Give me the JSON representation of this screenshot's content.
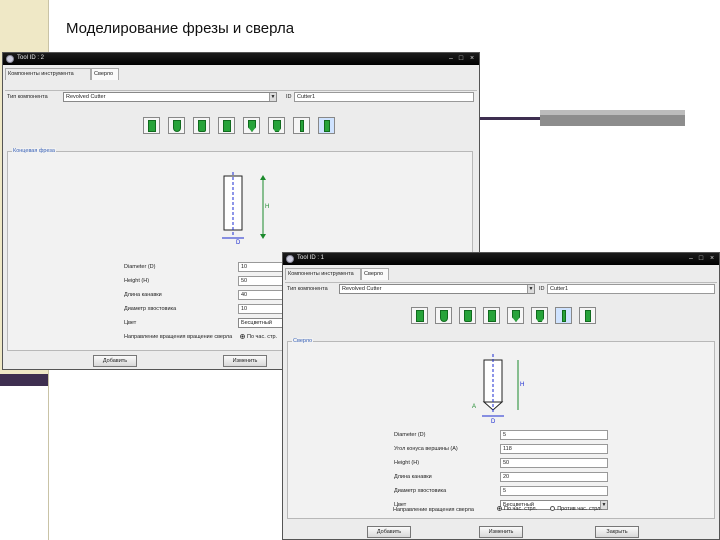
{
  "slide": {
    "title": "Моделирование фрезы и сверла"
  },
  "window1": {
    "title": "Tool ID : 2",
    "tabs": [
      "Компоненты инструмента",
      "Сверло"
    ],
    "type_label": "Тип компонента",
    "type_value": "Revolved Cutter",
    "id_label": "ID",
    "id_value": "Cutter1",
    "group_title": "Концевая фреза",
    "params": [
      {
        "label": "Diameter (D)",
        "value": "10"
      },
      {
        "label": "Height (H)",
        "value": "50"
      },
      {
        "label": "Длина канавки",
        "value": "40"
      },
      {
        "label": "Диаметр хвостовика",
        "value": "10"
      },
      {
        "label": "Цвет",
        "value": "Бесцветный"
      }
    ],
    "direction_label": "Направление вращения вращение сверла",
    "direction_option": "По час. стр.",
    "btn_add": "Добавить",
    "btn_change": "Изменить"
  },
  "window2": {
    "title": "Tool ID : 1",
    "tabs": [
      "Компоненты инструмента",
      "Сверло"
    ],
    "type_label": "Тип компонента",
    "type_value": "Revolved Cutter",
    "id_label": "ID",
    "id_value": "Cutter1",
    "group_title": "Сверло",
    "params": [
      {
        "label": "Diameter (D)",
        "value": "5"
      },
      {
        "label": "Угол конуса вершины (A)",
        "value": "118"
      },
      {
        "label": "Height (H)",
        "value": "50"
      },
      {
        "label": "Длина канавки",
        "value": "20"
      },
      {
        "label": "Диаметр хвостовика",
        "value": "5"
      },
      {
        "label": "Цвет",
        "value": "Бесцветный"
      }
    ],
    "direction_label": "Направление вращения сверла",
    "direction_options": [
      "По час. стрл.",
      "Против час. стрл."
    ],
    "btn_add": "Добавить",
    "btn_change": "Изменить",
    "btn_close": "Закрыть"
  },
  "diagram_labels": {
    "h": "H",
    "d": "D",
    "a": "A"
  },
  "colors": {
    "accent_green": "#27a33a",
    "group_title": "#3a63b8",
    "bar_dark": "#3e2f50"
  }
}
